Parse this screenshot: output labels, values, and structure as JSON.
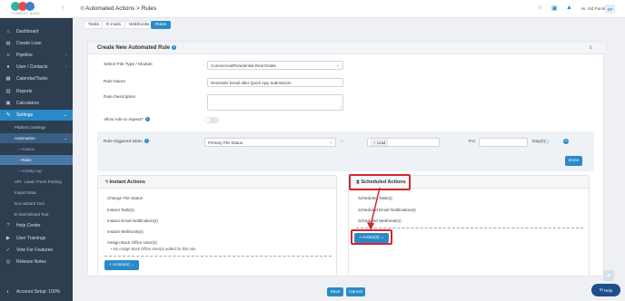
{
  "brand": {
    "company_name": "COMPANY NAME"
  },
  "sidebar": {
    "items": [
      {
        "label": "Dashboard",
        "icon": "dashboard-icon"
      },
      {
        "label": "Create Loan",
        "icon": "file-plus-icon"
      },
      {
        "label": "Pipeline",
        "icon": "pipeline-icon"
      },
      {
        "label": "User / Contacts",
        "icon": "user-icon"
      },
      {
        "label": "Calendar/Tasks",
        "icon": "calendar-icon"
      },
      {
        "label": "Reports",
        "icon": "reports-icon"
      },
      {
        "label": "Calculators",
        "icon": "calculator-icon"
      },
      {
        "label": "Settings",
        "icon": "settings-icon"
      },
      {
        "label": "Help Center",
        "icon": "help-icon"
      },
      {
        "label": "User Trainings",
        "icon": "training-icon"
      },
      {
        "label": "Vote For Features",
        "icon": "vote-icon"
      },
      {
        "label": "Release Notes",
        "icon": "release-icon"
      }
    ],
    "settings_sub": {
      "platform_settings": "Platform Settings",
      "automation": "Automation",
      "actions": "Actions",
      "rules": "Rules",
      "activity_log": "Activity Log",
      "api": "API - Lead / Form Posting",
      "import_data": "Import Data",
      "doc_wizard": "Doc Wizard Tool",
      "email_wizard": "E-mail Wizard Tool"
    },
    "account_setup": "Account Setup: 100%"
  },
  "topbar": {
    "title": "Automated Actions > Rules",
    "user_name": "Hi, Sid Parulio",
    "user_initials": "SP"
  },
  "tabs": [
    "Tasks",
    "E-mails",
    "Webhooks",
    "Rules"
  ],
  "form": {
    "card_title": "Create New Automated Rule",
    "file_type_label": "Select File Type / Module",
    "file_type_value": "Commercial/Residential Real Estate",
    "rule_name_label": "Rule Name",
    "rule_name_value": "Reminder Email after Quick App Submission",
    "rule_description_label": "Rule Description",
    "allow_repeat_label": "Allow rule to repeat?",
    "trigger_label": "Rule triggered when",
    "trigger_field_value": "Primary File Status",
    "trigger_status_value": "Lead",
    "for_label": "For",
    "days_label": "Day(s)",
    "done_button": "Done"
  },
  "instant_actions": {
    "title": "Instant Actions",
    "items": [
      "Change File Status",
      "Instant Task(s)",
      "Instant Email Notification(s)",
      "Instant Webhook(s)",
      "Assign Back Office User(s)"
    ],
    "note": "No Assign Back Office User(s) added for this rule",
    "button": "+ Action(s)"
  },
  "scheduled_actions": {
    "title": "Scheduled Actions",
    "items": [
      "Scheduled Task(s)",
      "Scheduled Email Notification(s)",
      "Scheduled Webhook(s)"
    ],
    "button": "+ Action(s)"
  },
  "footer": {
    "save": "Save",
    "cancel": "Cancel"
  },
  "chat_widget": "Help",
  "colors": {
    "accent": "#2a8ac8",
    "sidebar_bg": "#2c3e50",
    "highlight": "#d6252d"
  }
}
